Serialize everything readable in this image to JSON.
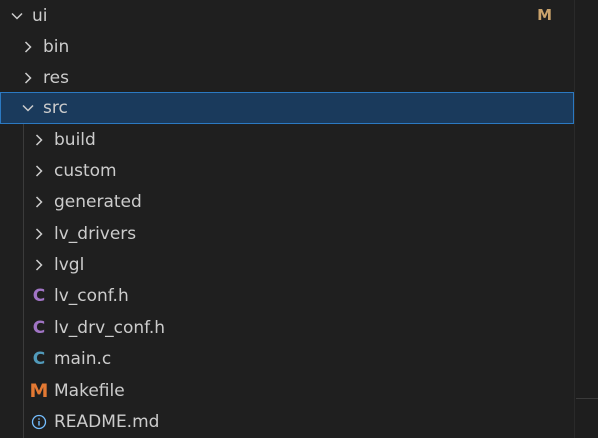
{
  "explorer": {
    "root": {
      "label": "ui",
      "badge": "M"
    },
    "items": [
      {
        "label": "bin"
      },
      {
        "label": "res"
      },
      {
        "label": "src"
      },
      {
        "label": "build"
      },
      {
        "label": "custom"
      },
      {
        "label": "generated"
      },
      {
        "label": "lv_drivers"
      },
      {
        "label": "lvgl"
      },
      {
        "label": "lv_conf.h",
        "icon": "C"
      },
      {
        "label": "lv_drv_conf.h",
        "icon": "C"
      },
      {
        "label": "main.c",
        "icon": "C"
      },
      {
        "label": "Makefile",
        "icon": "M"
      },
      {
        "label": "README.md"
      }
    ]
  },
  "colors": {
    "selection_bg": "#1a3a5c",
    "selection_border": "#2b79c2",
    "header_icon": "#a074c4",
    "c_source_icon": "#519aba",
    "makefile_icon": "#e37933",
    "info_icon": "#75beff",
    "badge": "#c9a26b"
  }
}
